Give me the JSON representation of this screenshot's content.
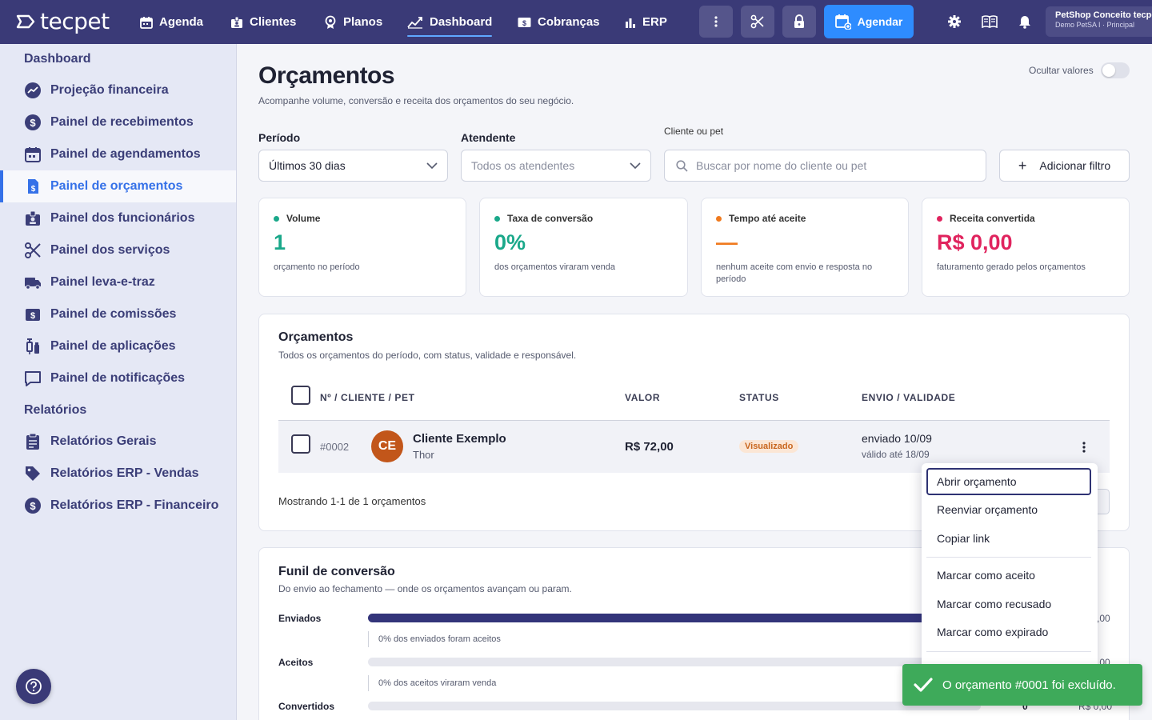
{
  "app": {
    "logo_text": "tecpet"
  },
  "nav": {
    "items": [
      {
        "label": "Agenda"
      },
      {
        "label": "Clientes"
      },
      {
        "label": "Planos"
      },
      {
        "label": "Dashboard",
        "active": true
      },
      {
        "label": "Cobranças"
      },
      {
        "label": "ERP"
      }
    ],
    "agendar_label": "Agendar",
    "store_name": "PetShop Conceito tecpet",
    "store_sub": "Demo PetSA I · Principal"
  },
  "sidebar": {
    "section_dashboard": "Dashboard",
    "dashboard_items": [
      {
        "label": "Projeção financeira",
        "icon": "trend-chart-icon"
      },
      {
        "label": "Painel de recebimentos",
        "icon": "dollar-circle-icon"
      },
      {
        "label": "Painel de agendamentos",
        "icon": "calendar-icon"
      },
      {
        "label": "Painel de orçamentos",
        "icon": "quote-document-icon",
        "active": true
      },
      {
        "label": "Painel dos funcionários",
        "icon": "id-badge-icon"
      },
      {
        "label": "Painel dos serviços",
        "icon": "scissors-icon"
      },
      {
        "label": "Painel leva-e-traz",
        "icon": "truck-icon"
      },
      {
        "label": "Painel de comissões",
        "icon": "dollar-bill-icon"
      },
      {
        "label": "Painel de aplicações",
        "icon": "syringe-icon"
      },
      {
        "label": "Painel de notificações",
        "icon": "message-icon"
      }
    ],
    "section_reports": "Relatórios",
    "report_items": [
      {
        "label": "Relatórios Gerais",
        "icon": "clipboard-icon"
      },
      {
        "label": "Relatórios ERP - Vendas",
        "icon": "tag-icon"
      },
      {
        "label": "Relatórios ERP - Financeiro",
        "icon": "dollar-circle-icon"
      }
    ]
  },
  "page": {
    "title": "Orçamentos",
    "subtitle": "Acompanhe volume, conversão e receita dos orçamentos do seu negócio.",
    "hide_values_label": "Ocultar valores",
    "hide_values_on": false
  },
  "filters": {
    "period_label": "Período",
    "period_value": "Últimos 30 dias",
    "attendant_label": "Atendente",
    "attendant_placeholder": "Todos os atendentes",
    "search_label": "Cliente ou pet",
    "search_placeholder": "Buscar por nome do cliente ou pet",
    "add_filter_label": "Adicionar filtro"
  },
  "kpis": [
    {
      "title": "Volume",
      "value": "1",
      "desc": "orçamento no período",
      "color": "#1aa88a"
    },
    {
      "title": "Taxa de conversão",
      "value": "0%",
      "desc": "dos orçamentos viraram venda",
      "color": "#1aa88a"
    },
    {
      "title": "Tempo até aceite",
      "value": "—",
      "desc": "nenhum aceite com envio e resposta no período",
      "color": "#f07a1e"
    },
    {
      "title": "Receita convertida",
      "value": "R$ 0,00",
      "desc": "faturamento gerado pelos orçamentos",
      "color": "#e0245e"
    }
  ],
  "quotes": {
    "title": "Orçamentos",
    "subtitle": "Todos os orçamentos do período, com status, validade e responsável.",
    "columns": {
      "client": "Nº / CLIENTE / PET",
      "value": "VALOR",
      "status": "STATUS",
      "validity": "ENVIO / VALIDADE"
    },
    "rows": [
      {
        "number": "#0002",
        "initials": "CE",
        "client": "Cliente Exemplo",
        "pet": "Thor",
        "value": "R$ 72,00",
        "status": "Visualizado",
        "sent": "enviado 10/09",
        "valid": "válido até 18/09"
      }
    ],
    "footer": "Mostrando 1-1 de 1 orçamentos"
  },
  "row_menu": {
    "items": [
      "Abrir orçamento",
      "Reenviar orçamento",
      "Copiar link",
      "Marcar como aceito",
      "Marcar como recusado",
      "Marcar como expirado"
    ]
  },
  "funnel": {
    "title": "Funil de conversão",
    "subtitle": "Do envio ao fechamento — onde os orçamentos avançam ou param.",
    "stages": [
      {
        "label": "Enviados",
        "fill": 1.0,
        "right": ",00",
        "note": "0% dos enviados foram aceitos"
      },
      {
        "label": "Aceitos",
        "fill": 0.0,
        "right": ",00",
        "note": "0% dos aceitos viraram venda"
      },
      {
        "label": "Convertidos",
        "fill": 0.0,
        "count": "0",
        "right": "R$ 0,00"
      }
    ]
  },
  "toast": {
    "message": "O orçamento #0001 foi excluído."
  },
  "colors": {
    "nav_bg": "#3a3a77",
    "accent": "#3571e8",
    "primary_button": "#2e8cff",
    "toast": "#3eaa5a"
  }
}
